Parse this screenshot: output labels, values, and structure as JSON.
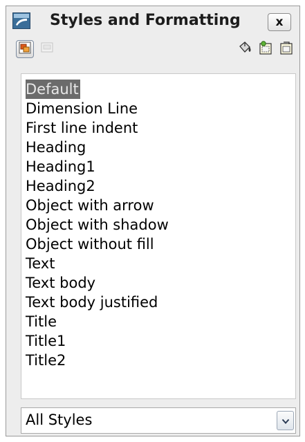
{
  "window": {
    "title": "Styles and Formatting",
    "close_label": "x"
  },
  "toolbar": {
    "buttons": [
      {
        "name": "graphics-styles",
        "icon": "graphics-styles-icon",
        "active": true
      },
      {
        "name": "presentation-styles",
        "icon": "presentation-styles-icon",
        "active": false
      },
      {
        "name": "fill-format-mode",
        "icon": "paint-bucket-icon",
        "active": false
      },
      {
        "name": "new-style-from-selection",
        "icon": "new-style-icon",
        "active": false
      },
      {
        "name": "update-style",
        "icon": "update-style-icon",
        "active": false
      }
    ]
  },
  "styles": {
    "items": [
      "Default",
      "Dimension Line",
      "First line indent",
      "Heading",
      "Heading1",
      "Heading2",
      "Object with arrow",
      "Object with shadow",
      "Object without fill",
      "Text",
      "Text body",
      "Text body justified",
      "Title",
      "Title1",
      "Title2"
    ],
    "selected_index": 0
  },
  "filter": {
    "value": "All Styles"
  },
  "colors": {
    "selection": "#6b6b6b",
    "window_bg": "#ededed"
  }
}
